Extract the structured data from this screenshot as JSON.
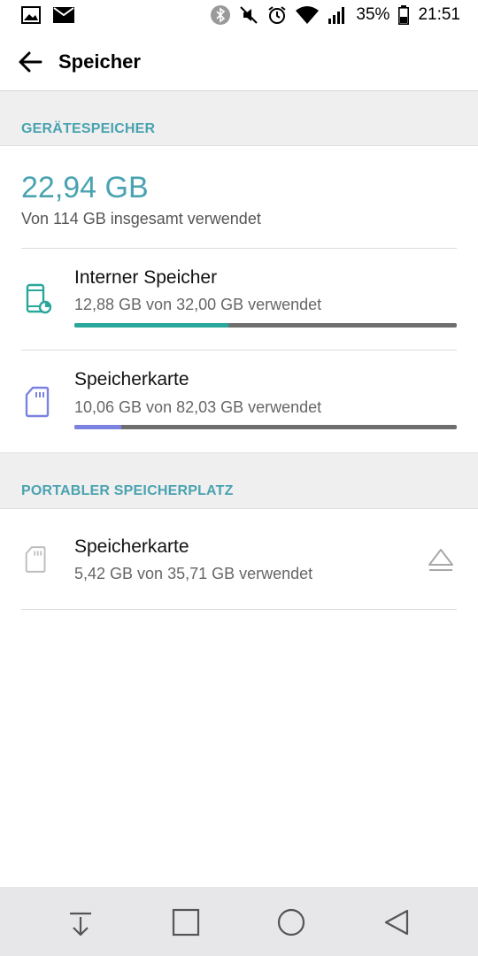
{
  "status_bar": {
    "battery": "35%",
    "time": "21:51",
    "icons": [
      "image-icon",
      "mail-icon",
      "bluetooth-icon",
      "mute-icon",
      "alarm-icon",
      "wifi-icon",
      "signal-icon",
      "battery-icon"
    ]
  },
  "app_bar": {
    "title": "Speicher"
  },
  "device_storage": {
    "header": "GERÄTESPEICHER",
    "total_used": "22,94 GB",
    "total_sub": "Von 114 GB insgesamt verwendet",
    "items": [
      {
        "title": "Interner Speicher",
        "sub": "12,88 GB von 32,00 GB verwendet",
        "fraction": 0.4025,
        "color": "#2aa79b",
        "icon": "phone-storage-icon"
      },
      {
        "title": "Speicherkarte",
        "sub": "10,06 GB von 82,03 GB verwendet",
        "fraction": 0.1226,
        "color": "#7b82e0",
        "icon": "sd-card-icon"
      }
    ]
  },
  "portable_storage": {
    "header": "PORTABLER SPEICHERPLATZ",
    "items": [
      {
        "title": "Speicherkarte",
        "sub": "5,42 GB von 35,71 GB verwendet",
        "icon": "sd-card-icon",
        "action": "eject-icon"
      }
    ]
  },
  "nav_bar": {
    "icons": [
      "notification-pull-icon",
      "recents-icon",
      "home-icon",
      "back-icon"
    ]
  }
}
